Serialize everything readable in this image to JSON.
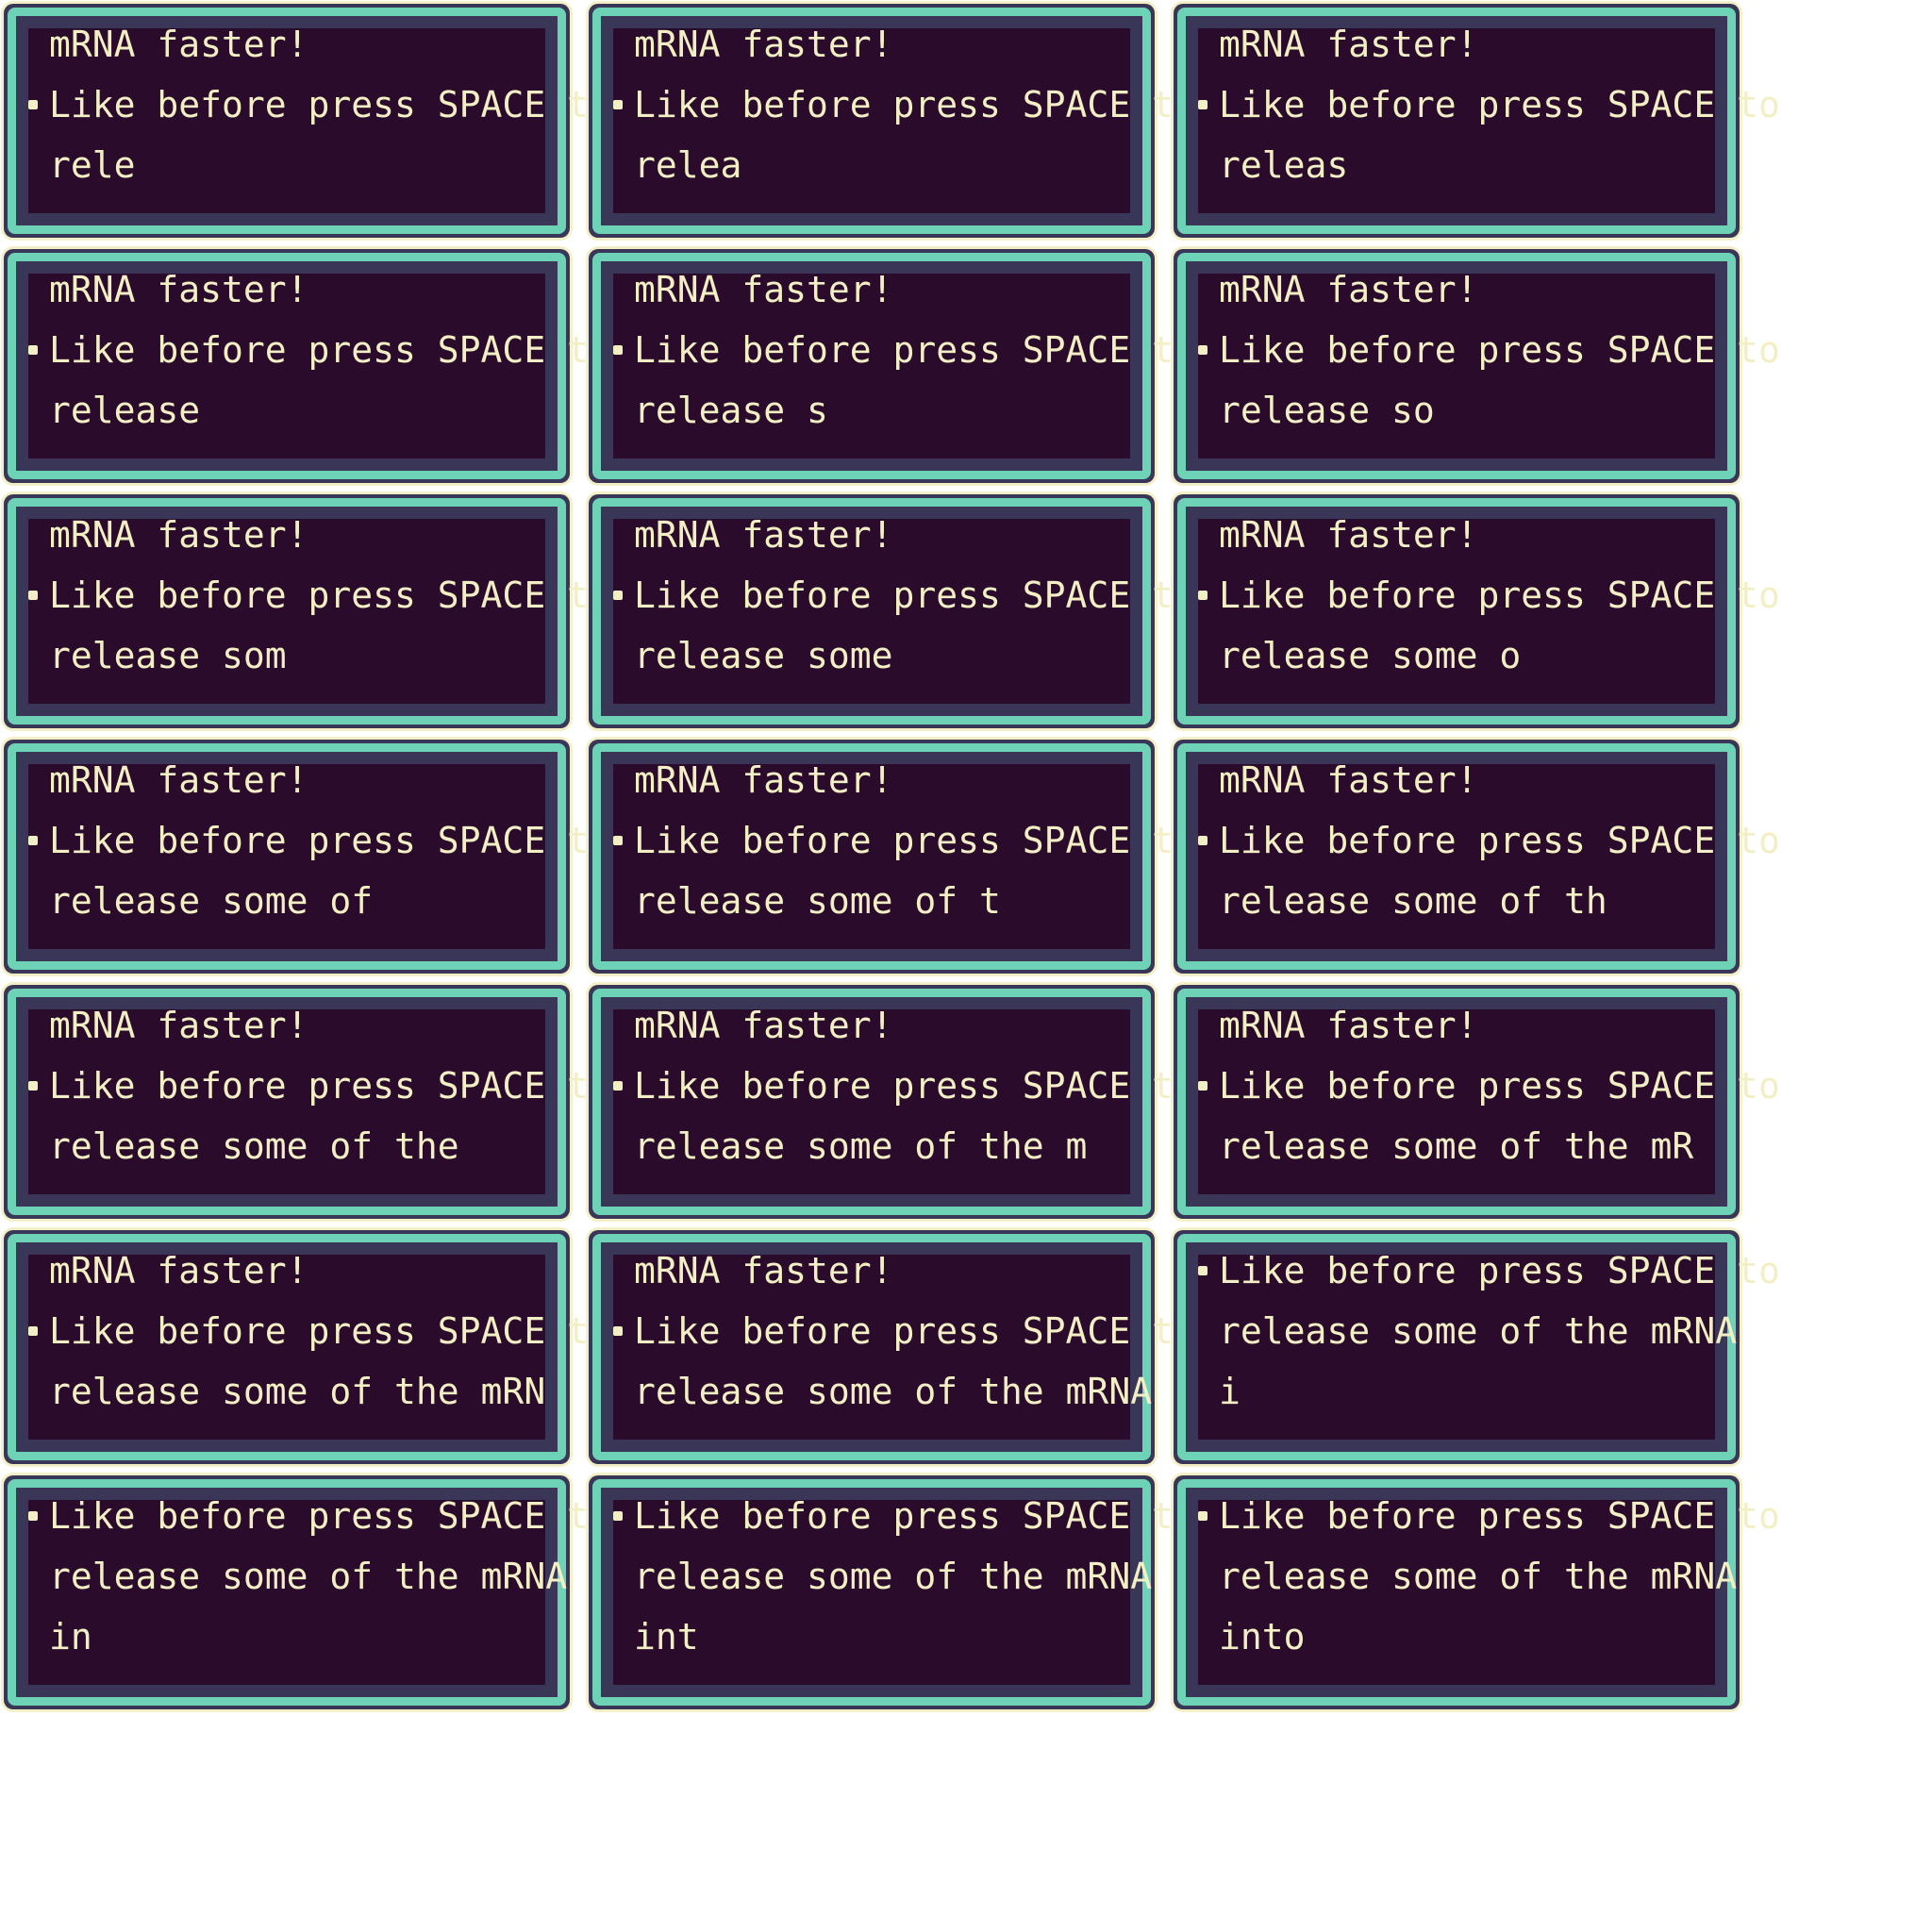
{
  "frames": [
    {
      "bullet_line": 2,
      "lines": [
        "mRNA faster!",
        "Like before press SPACE to",
        "rele"
      ]
    },
    {
      "bullet_line": 2,
      "lines": [
        "mRNA faster!",
        "Like before press SPACE to",
        "relea"
      ]
    },
    {
      "bullet_line": 2,
      "lines": [
        "mRNA faster!",
        "Like before press SPACE to",
        "releas"
      ]
    },
    {
      "bullet_line": 2,
      "lines": [
        "mRNA faster!",
        "Like before press SPACE to",
        "release"
      ]
    },
    {
      "bullet_line": 2,
      "lines": [
        "mRNA faster!",
        "Like before press SPACE to",
        "release s"
      ]
    },
    {
      "bullet_line": 2,
      "lines": [
        "mRNA faster!",
        "Like before press SPACE to",
        "release so"
      ]
    },
    {
      "bullet_line": 2,
      "lines": [
        "mRNA faster!",
        "Like before press SPACE to",
        "release som"
      ]
    },
    {
      "bullet_line": 2,
      "lines": [
        "mRNA faster!",
        "Like before press SPACE to",
        "release some"
      ]
    },
    {
      "bullet_line": 2,
      "lines": [
        "mRNA faster!",
        "Like before press SPACE to",
        "release some o"
      ]
    },
    {
      "bullet_line": 2,
      "lines": [
        "mRNA faster!",
        "Like before press SPACE to",
        "release some of"
      ]
    },
    {
      "bullet_line": 2,
      "lines": [
        "mRNA faster!",
        "Like before press SPACE to",
        "release some of t"
      ]
    },
    {
      "bullet_line": 2,
      "lines": [
        "mRNA faster!",
        "Like before press SPACE to",
        "release some of th"
      ]
    },
    {
      "bullet_line": 2,
      "lines": [
        "mRNA faster!",
        "Like before press SPACE to",
        "release some of the"
      ]
    },
    {
      "bullet_line": 2,
      "lines": [
        "mRNA faster!",
        "Like before press SPACE to",
        "release some of the m"
      ]
    },
    {
      "bullet_line": 2,
      "lines": [
        "mRNA faster!",
        "Like before press SPACE to",
        "release some of the mR"
      ]
    },
    {
      "bullet_line": 2,
      "lines": [
        "mRNA faster!",
        "Like before press SPACE to",
        "release some of the mRN"
      ]
    },
    {
      "bullet_line": 2,
      "lines": [
        "mRNA faster!",
        "Like before press SPACE to",
        "release some of the mRNA"
      ]
    },
    {
      "bullet_line": 1,
      "lines": [
        "Like before press SPACE to",
        "release some of the mRNA",
        "i"
      ]
    },
    {
      "bullet_line": 1,
      "lines": [
        "Like before press SPACE to",
        "release some of the mRNA",
        "in"
      ]
    },
    {
      "bullet_line": 1,
      "lines": [
        "Like before press SPACE to",
        "release some of the mRNA",
        "int"
      ]
    },
    {
      "bullet_line": 1,
      "lines": [
        "Like before press SPACE to",
        "release some of the mRNA",
        "into"
      ]
    }
  ],
  "colors": {
    "page_background": "#ffffff",
    "outer_border": "#f3f0c8",
    "mid_border": "#3a3657",
    "accent_border": "#6ed3b6",
    "panel_fill": "#2b0b2b",
    "text": "#f3efc4"
  }
}
